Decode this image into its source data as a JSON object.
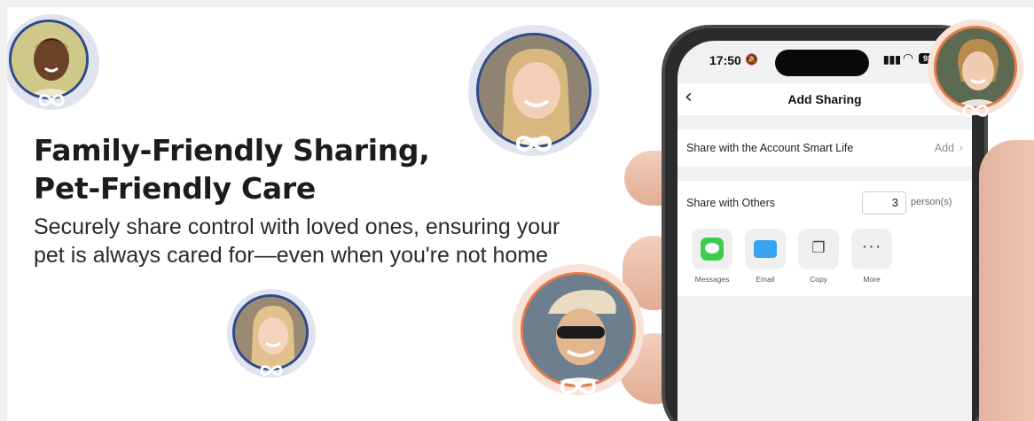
{
  "headline": {
    "line1": "Family-Friendly Sharing,",
    "line2": "Pet-Friendly Care"
  },
  "subcopy": "Securely share control with loved ones, ensuring your pet is always cared for—even when you're not home",
  "phone": {
    "status": {
      "time": "17:50",
      "battery": "93",
      "icons": [
        "bell-mute-icon",
        "signal-icon",
        "wifi-icon",
        "battery-icon"
      ]
    },
    "nav": {
      "back_icon": "chevron-left-icon",
      "title": "Add Sharing"
    },
    "account_row": {
      "label": "Share with the Account Smart Life",
      "action": "Add",
      "chevron": "›"
    },
    "others": {
      "label": "Share with Others",
      "count": "3",
      "unit": "person(s)",
      "options": [
        {
          "label": "Messages",
          "icon": "messages-icon"
        },
        {
          "label": "Email",
          "icon": "email-icon"
        },
        {
          "label": "Copy",
          "icon": "copy-icon"
        },
        {
          "label": "More",
          "icon": "more-icon"
        }
      ]
    }
  },
  "colors": {
    "ring_blue": "#2f4a8a",
    "ring_orange": "#e57a49",
    "messages_green": "#3ecb4e",
    "email_blue": "#3aa5ef"
  }
}
